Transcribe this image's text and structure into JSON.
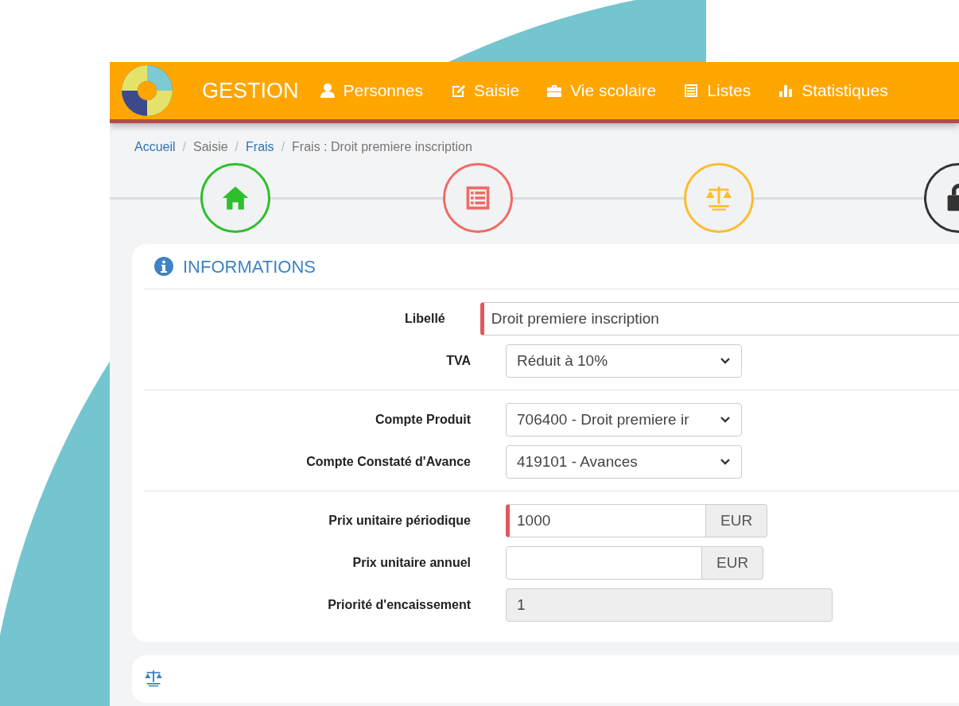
{
  "navbar": {
    "brand": "GESTION",
    "items": [
      {
        "label": "Personnes"
      },
      {
        "label": "Saisie"
      },
      {
        "label": "Vie scolaire"
      },
      {
        "label": "Listes"
      },
      {
        "label": "Statistiques"
      }
    ]
  },
  "breadcrumb": [
    {
      "label": "Accueil",
      "kind": "link"
    },
    {
      "label": "/",
      "kind": "separator"
    },
    {
      "label": "Saisie",
      "kind": "text"
    },
    {
      "label": "/",
      "kind": "separator"
    },
    {
      "label": "Frais",
      "kind": "link"
    },
    {
      "label": "/",
      "kind": "separator"
    },
    {
      "label": "Frais : Droit premiere inscription",
      "kind": "text"
    }
  ],
  "steps": [
    {
      "color": "#2dbf2d"
    },
    {
      "color": "#ef6b64"
    },
    {
      "color": "#fbbd2c"
    },
    {
      "color": "#333333"
    }
  ],
  "informations": {
    "title": "INFORMATIONS",
    "groups": [
      [
        {
          "label": "Libellé",
          "kind": "text",
          "value": "Droit premiere inscription",
          "required": true
        },
        {
          "label": "TVA",
          "kind": "select",
          "value": "Réduit à 10%"
        }
      ],
      [
        {
          "label": "Compte Produit",
          "kind": "select",
          "value": "706400 - Droit premiere ir"
        },
        {
          "label": "Compte Constaté d'Avance",
          "kind": "select",
          "value": "419101 - Avances"
        }
      ],
      [
        {
          "label": "Prix unitaire périodique",
          "kind": "addon",
          "value": "1000",
          "addon": "EUR",
          "required": true
        },
        {
          "label": "Prix unitaire annuel",
          "kind": "addon",
          "addon": "EUR",
          "required": false
        },
        {
          "label": "Priorité d'encaissement",
          "kind": "readonly",
          "value": "1"
        }
      ]
    ]
  }
}
